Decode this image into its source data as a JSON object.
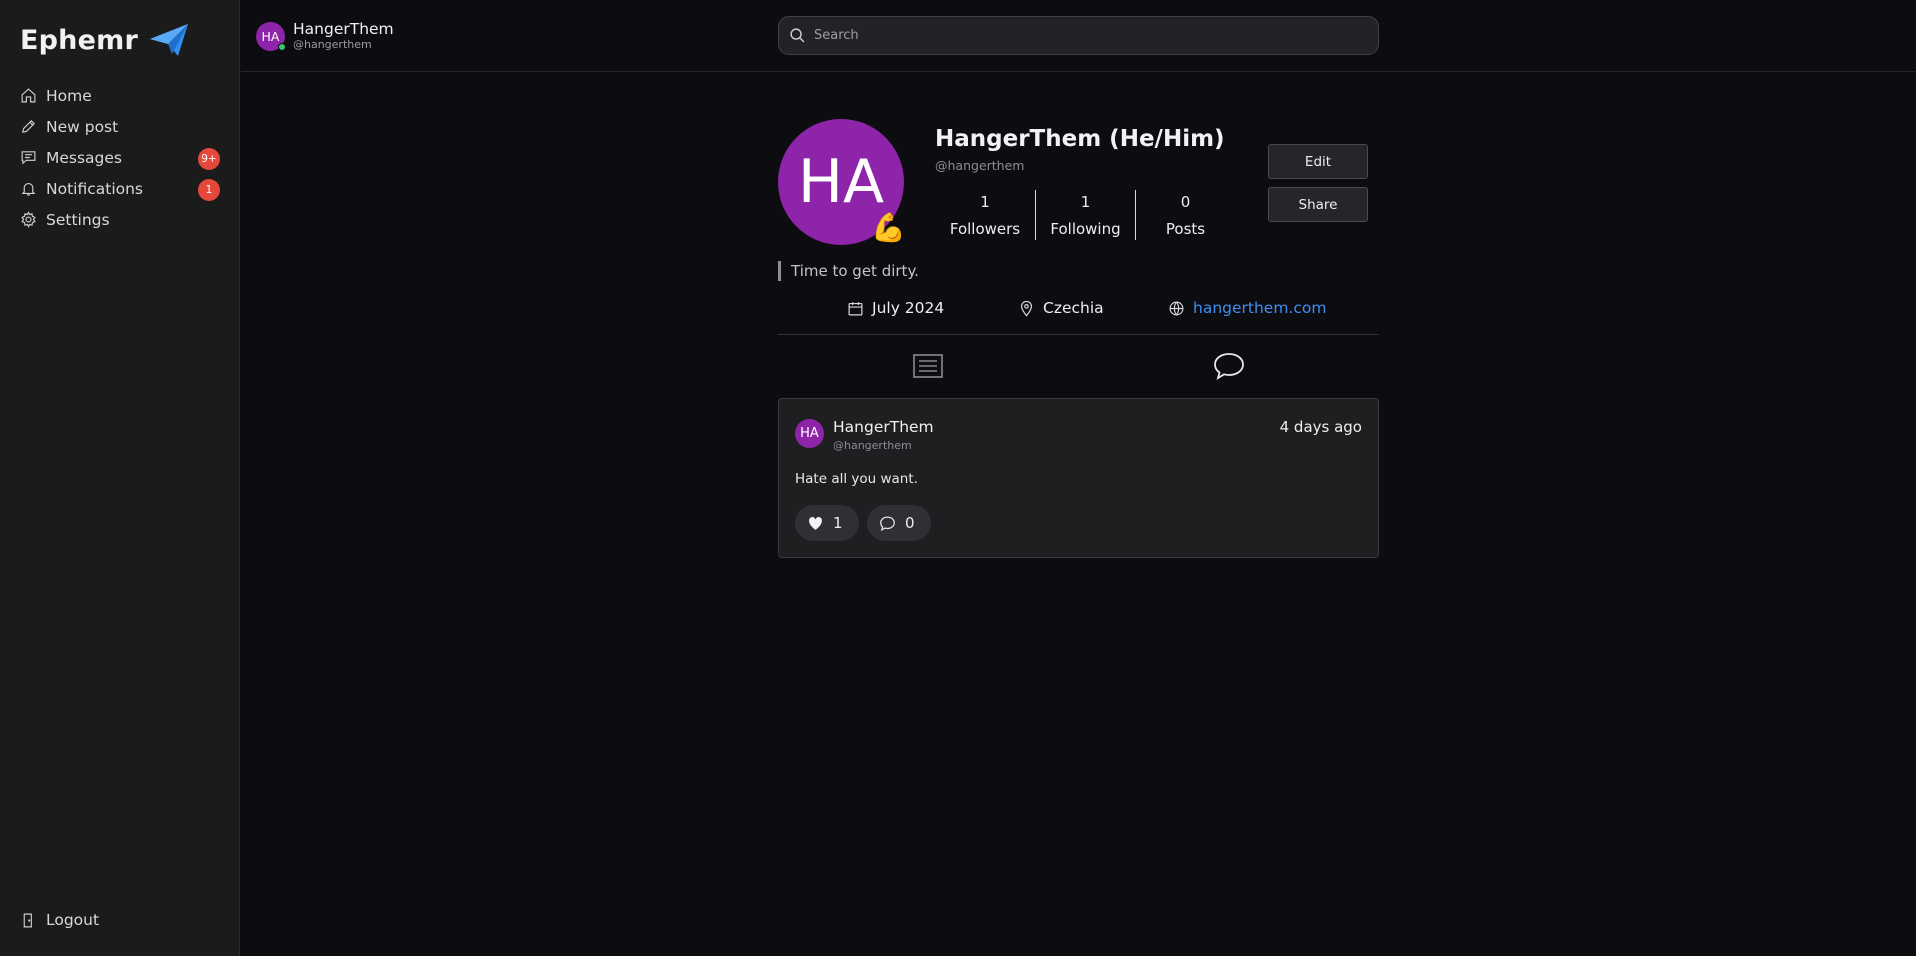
{
  "brand": {
    "name": "Ephemr",
    "logo_icon": "paper-plane-icon",
    "accent": "#2f8ff0"
  },
  "sidebar": {
    "items": [
      {
        "label": "Home",
        "icon": "home-icon"
      },
      {
        "label": "New post",
        "icon": "pencil-icon"
      },
      {
        "label": "Messages",
        "icon": "message-icon",
        "badge": "9+"
      },
      {
        "label": "Notifications",
        "icon": "bell-icon",
        "badge": "1"
      },
      {
        "label": "Settings",
        "icon": "gear-icon"
      }
    ],
    "logout": "Logout"
  },
  "header": {
    "user": {
      "initials": "HA",
      "name": "HangerThem",
      "handle": "@hangerthem",
      "status": "online"
    },
    "search": {
      "placeholder": "Search",
      "value": ""
    }
  },
  "profile": {
    "initials": "HA",
    "emoji": "💪",
    "name": "HangerThem (He/Him)",
    "handle": "@hangerthem",
    "stats": [
      {
        "value": "1",
        "label": "Followers"
      },
      {
        "value": "1",
        "label": "Following"
      },
      {
        "value": "0",
        "label": "Posts"
      }
    ],
    "edit_label": "Edit",
    "share_label": "Share",
    "bio": "Time to get dirty.",
    "joined": "July 2024",
    "location": "Czechia",
    "website": "hangerthem.com"
  },
  "tabs": [
    {
      "icon": "posts-list-icon"
    },
    {
      "icon": "comment-bubble-icon"
    }
  ],
  "posts": [
    {
      "initials": "HA",
      "author": "HangerThem",
      "handle": "@hangerthem",
      "time": "4 days ago",
      "text": "Hate all you want.",
      "likes": "1",
      "comments": "0"
    }
  ],
  "colors": {
    "avatar": "#8e24aa",
    "badge": "#e5483b",
    "link": "#3d8ef0",
    "online": "#3cc36b"
  }
}
